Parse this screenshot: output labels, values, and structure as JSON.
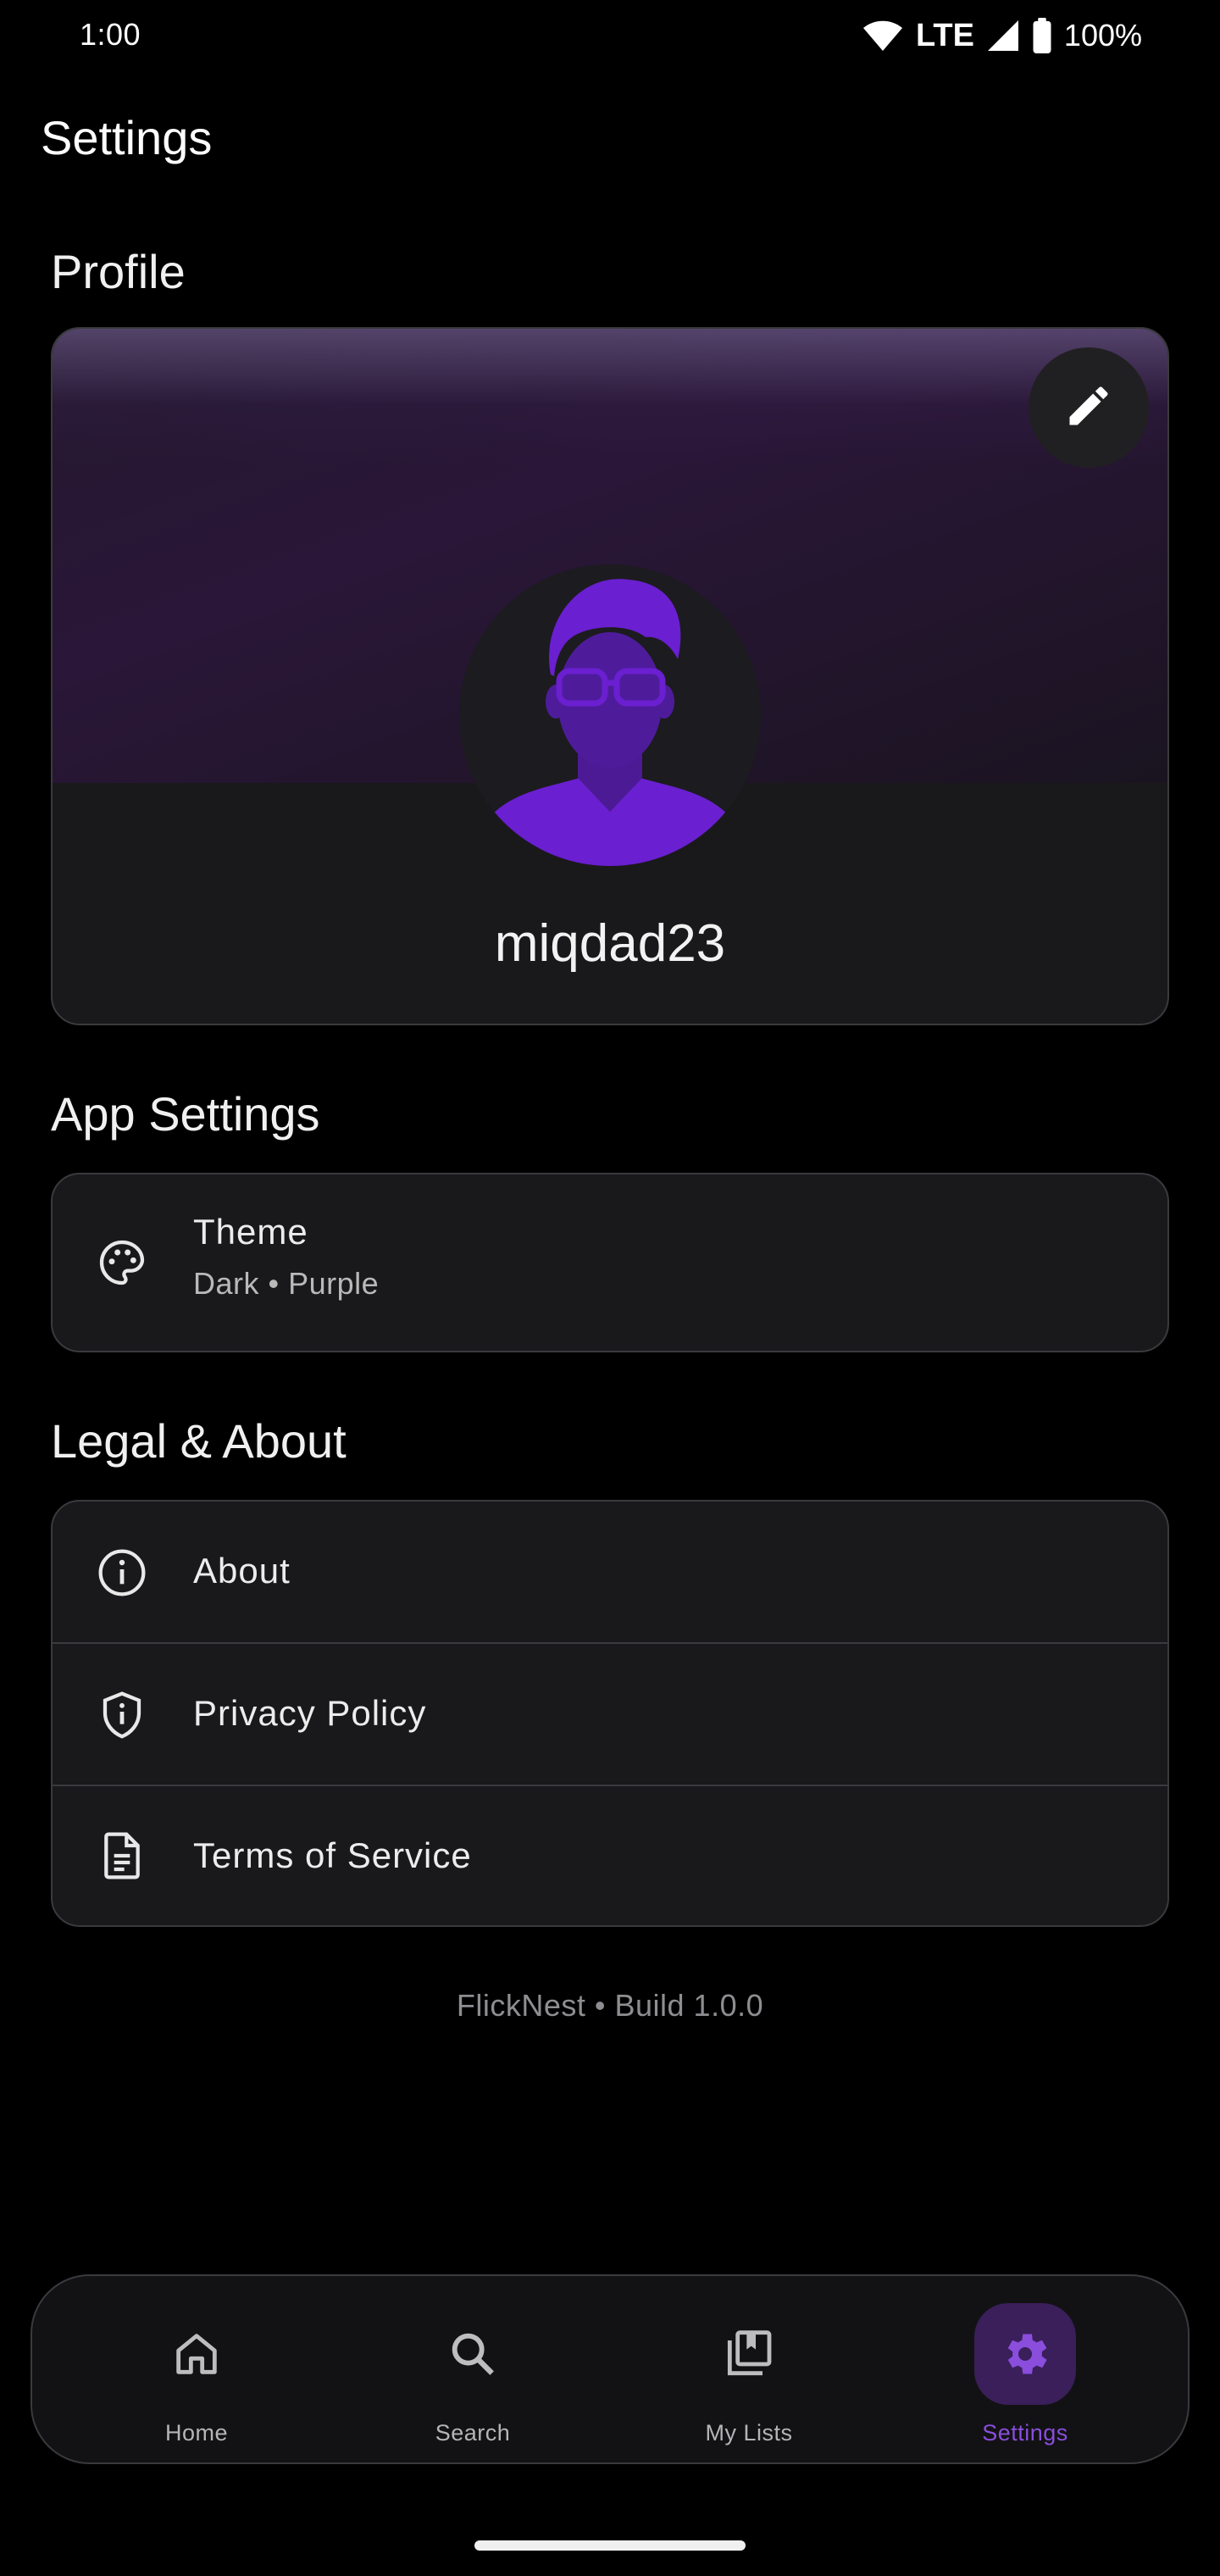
{
  "status_bar": {
    "time": "1:00",
    "network": "LTE",
    "battery": "100%"
  },
  "page": {
    "title": "Settings"
  },
  "profile": {
    "section_title": "Profile",
    "username": "miqdad23"
  },
  "app_settings": {
    "section_title": "App Settings",
    "theme_label": "Theme",
    "theme_value": "Dark • Purple"
  },
  "legal": {
    "section_title": "Legal & About",
    "items": [
      {
        "label": "About",
        "icon": "info-icon"
      },
      {
        "label": "Privacy Policy",
        "icon": "shield-icon"
      },
      {
        "label": "Terms of Service",
        "icon": "document-icon"
      }
    ]
  },
  "footer": {
    "build": "FlickNest • Build 1.0.0"
  },
  "nav": {
    "items": [
      {
        "label": "Home",
        "icon": "home-icon"
      },
      {
        "label": "Search",
        "icon": "search-icon"
      },
      {
        "label": "My Lists",
        "icon": "library-icon"
      },
      {
        "label": "Settings",
        "icon": "gear-icon",
        "active": true
      }
    ]
  },
  "colors": {
    "background": "#000000",
    "card": "#19191b",
    "border": "#3a3a3e",
    "accent": "#8a4ddc",
    "avatar_purple": "#6a1fd0"
  }
}
